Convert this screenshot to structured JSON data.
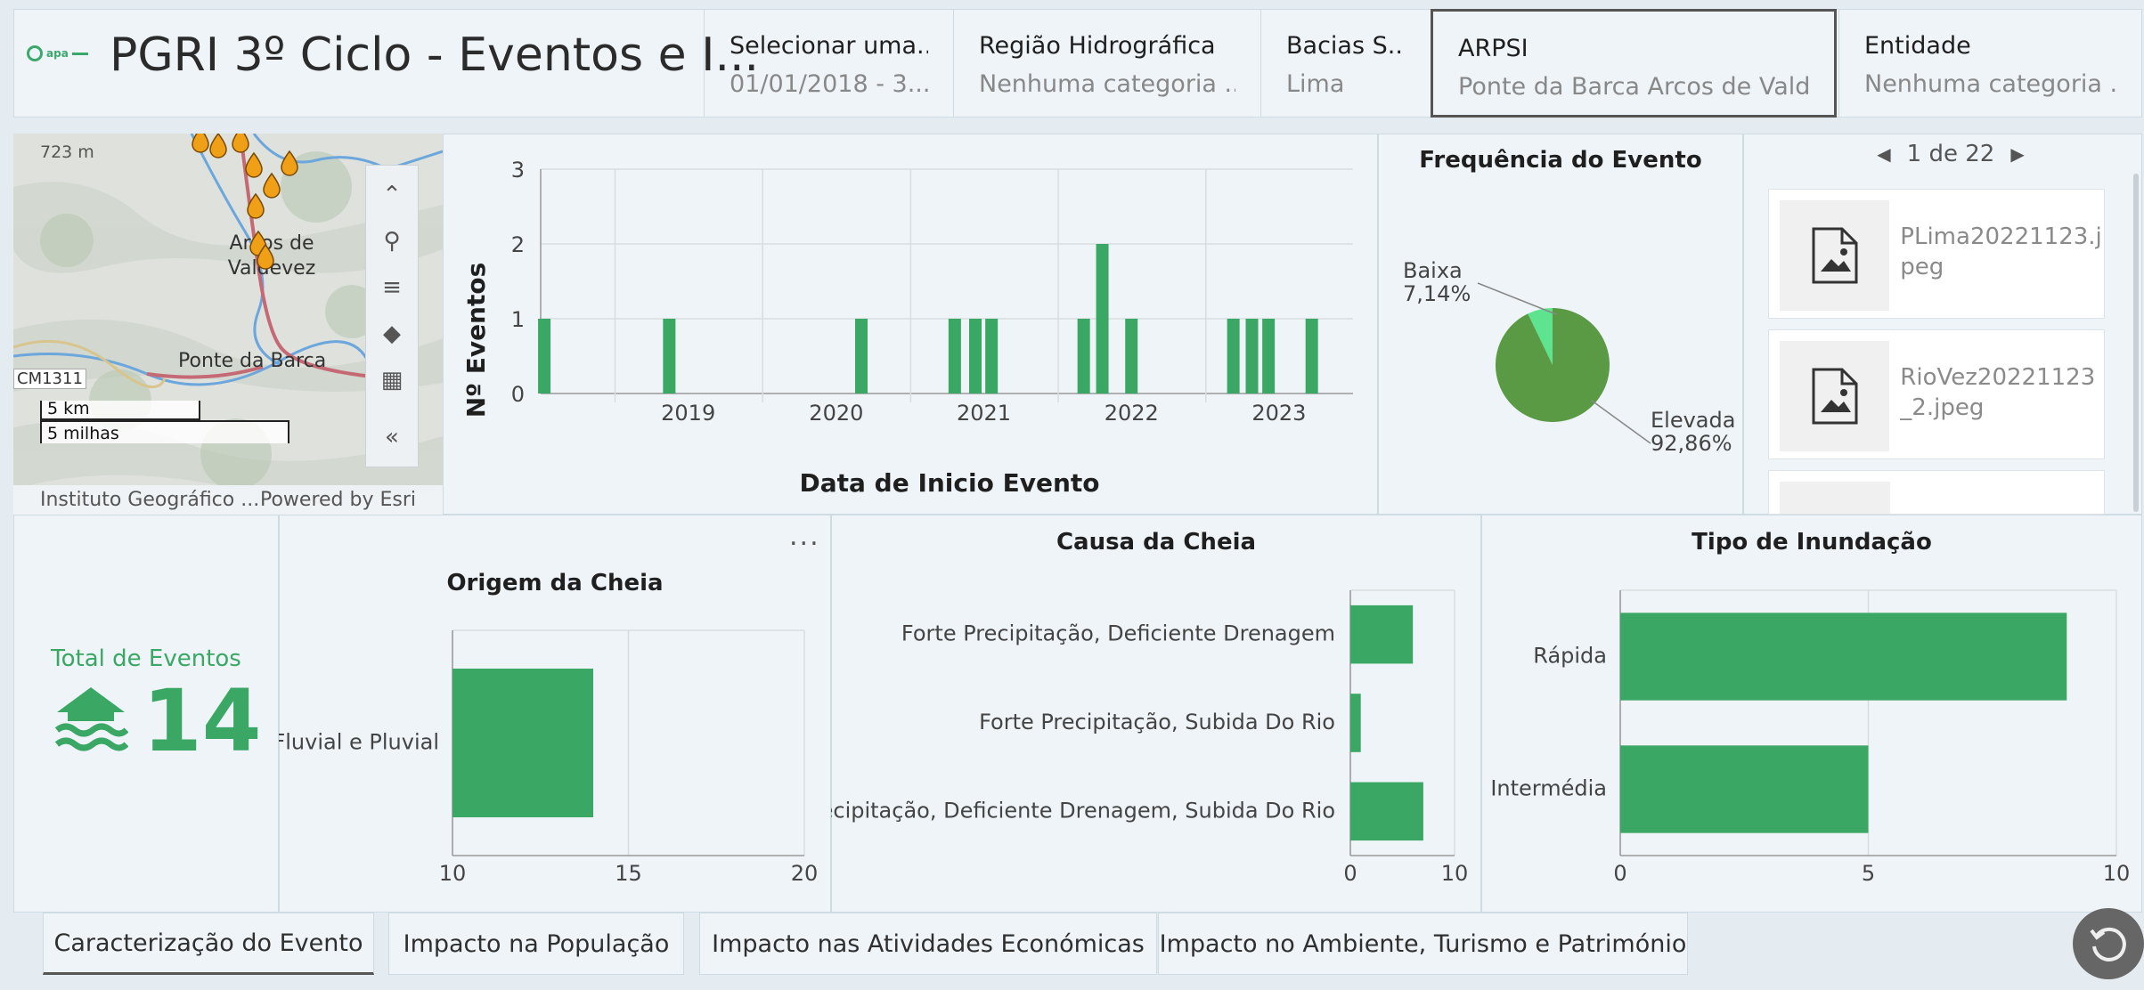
{
  "header": {
    "logo_text": "apa",
    "title": "PGRI 3º Ciclo - Eventos e I...",
    "selectors": [
      {
        "label": "Selecionar uma...",
        "value": "01/01/2018 - 3..."
      },
      {
        "label": "Região Hidrográfica",
        "value": "Nenhuma categoria ..."
      },
      {
        "label": "Bacias S...",
        "value": "Lima"
      },
      {
        "label": "ARPSI",
        "value": "Ponte da Barca Arcos de Valde..."
      },
      {
        "label": "Entidade",
        "value": "Nenhuma categoria ..."
      }
    ]
  },
  "map": {
    "place_labels": [
      "723 m",
      "Arcos de Valdevez",
      "Ponte da Barca",
      "CM1311"
    ],
    "scale": {
      "km": "5 km",
      "miles": "5 milhas"
    },
    "attribution_left": "Instituto Geográfico ...",
    "attribution_right": "Powered by Esri",
    "tools": [
      "collapse-up-icon",
      "search-icon",
      "legend-icon",
      "layers-icon",
      "qr-icon",
      "collapse-left-icon"
    ]
  },
  "colors": {
    "bar": "#3aa864",
    "pie_major": "#5a9a45",
    "pie_minor": "#5ee38e",
    "marker": "#f0a016"
  },
  "timeline": {
    "chart_data": {
      "type": "bar",
      "title": "",
      "xlabel": "Data de Inicio Evento",
      "ylabel": "Nº Eventos",
      "ylim": [
        0,
        3
      ],
      "yticks": [
        "0",
        "1",
        "2",
        "3"
      ],
      "x_ticks": [
        "2019",
        "2020",
        "2021",
        "2022",
        "2023"
      ],
      "x_range": [
        "2018-07-01",
        "2023-12-31"
      ],
      "events": [
        {
          "date": "2018-07-10",
          "value": 1
        },
        {
          "date": "2019-05-15",
          "value": 1
        },
        {
          "date": "2020-09-01",
          "value": 1
        },
        {
          "date": "2021-04-20",
          "value": 1
        },
        {
          "date": "2021-06-10",
          "value": 1
        },
        {
          "date": "2021-07-20",
          "value": 1
        },
        {
          "date": "2022-03-05",
          "value": 1
        },
        {
          "date": "2022-04-20",
          "value": 2
        },
        {
          "date": "2022-07-01",
          "value": 1
        },
        {
          "date": "2023-03-10",
          "value": 1
        },
        {
          "date": "2023-04-25",
          "value": 1
        },
        {
          "date": "2023-06-05",
          "value": 1
        },
        {
          "date": "2023-09-20",
          "value": 1
        }
      ]
    }
  },
  "frequency": {
    "title": "Frequência do Evento",
    "chart_data": {
      "type": "pie",
      "title": "Frequência do Evento",
      "slices": [
        {
          "name": "Elevada",
          "percent": 92.86,
          "label": "92,86%"
        },
        {
          "name": "Baixa",
          "percent": 7.14,
          "label": "7,14%"
        }
      ]
    }
  },
  "gallery": {
    "pager": "1 de 22",
    "items": [
      {
        "name": "PLima20221123.jpeg"
      },
      {
        "name": "RioVez20221123_2.jpeg"
      }
    ]
  },
  "total": {
    "label": "Total de Eventos",
    "value": "14"
  },
  "origem": {
    "more": "...",
    "chart_data": {
      "type": "bar",
      "orientation": "horizontal",
      "title": "Origem da Cheia",
      "categories": [
        "Fluvial e Pluvial"
      ],
      "values": [
        14
      ],
      "xlim": [
        10,
        20
      ],
      "xticks": [
        "10",
        "15",
        "20"
      ]
    }
  },
  "causa": {
    "chart_data": {
      "type": "bar",
      "orientation": "horizontal",
      "title": "Causa da Cheia",
      "categories": [
        "Forte Precipitação, Deficiente Drenagem",
        "Forte Precipitação, Subida Do Rio",
        "Forte Precipitação, Deficiente Drenagem, Subida Do Rio"
      ],
      "values": [
        6,
        1,
        7
      ],
      "xlim": [
        0,
        10
      ],
      "xticks": [
        "0",
        "10"
      ]
    }
  },
  "tipo": {
    "chart_data": {
      "type": "bar",
      "orientation": "horizontal",
      "title": "Tipo de Inundação",
      "categories": [
        "Rápida",
        "Intermédia"
      ],
      "values": [
        9,
        5
      ],
      "xlim": [
        0,
        10
      ],
      "xticks": [
        "0",
        "5",
        "10"
      ]
    }
  },
  "tabs": [
    {
      "label": "Caracterização do Evento"
    },
    {
      "label": "Impacto na População"
    },
    {
      "label": "Impacto nas Atividades Económicas"
    },
    {
      "label": "Impacto no Ambiente, Turismo e Património"
    }
  ]
}
